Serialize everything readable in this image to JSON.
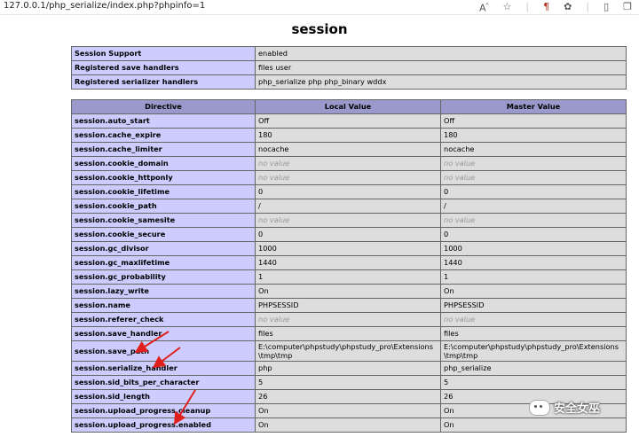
{
  "browser": {
    "url": "127.0.0.1/php_serialize/index.php?phpinfo=1",
    "icons": [
      "read-aloud-icon",
      "favorite-icon",
      "sidebar-icon",
      "extensions-icon",
      "split-screen-icon",
      "collections-icon"
    ]
  },
  "page": {
    "title": "session"
  },
  "summary_rows": [
    {
      "directive": "Session Support",
      "value": "enabled"
    },
    {
      "directive": "Registered save handlers",
      "value": "files user"
    },
    {
      "directive": "Registered serializer handlers",
      "value": "php_serialize php php_binary wddx"
    }
  ],
  "directives_header": {
    "directive": "Directive",
    "local": "Local Value",
    "master": "Master Value"
  },
  "directives": [
    {
      "name": "session.auto_start",
      "local": "Off",
      "master": "Off"
    },
    {
      "name": "session.cache_expire",
      "local": "180",
      "master": "180"
    },
    {
      "name": "session.cache_limiter",
      "local": "nocache",
      "master": "nocache"
    },
    {
      "name": "session.cookie_domain",
      "local": "no value",
      "master": "no value",
      "no_value": true
    },
    {
      "name": "session.cookie_httponly",
      "local": "no value",
      "master": "no value",
      "no_value": true
    },
    {
      "name": "session.cookie_lifetime",
      "local": "0",
      "master": "0"
    },
    {
      "name": "session.cookie_path",
      "local": "/",
      "master": "/"
    },
    {
      "name": "session.cookie_samesite",
      "local": "no value",
      "master": "no value",
      "no_value": true
    },
    {
      "name": "session.cookie_secure",
      "local": "0",
      "master": "0"
    },
    {
      "name": "session.gc_divisor",
      "local": "1000",
      "master": "1000"
    },
    {
      "name": "session.gc_maxlifetime",
      "local": "1440",
      "master": "1440"
    },
    {
      "name": "session.gc_probability",
      "local": "1",
      "master": "1"
    },
    {
      "name": "session.lazy_write",
      "local": "On",
      "master": "On"
    },
    {
      "name": "session.name",
      "local": "PHPSESSID",
      "master": "PHPSESSID"
    },
    {
      "name": "session.referer_check",
      "local": "no value",
      "master": "no value",
      "no_value": true
    },
    {
      "name": "session.save_handler",
      "local": "files",
      "master": "files"
    },
    {
      "name": "session.save_path",
      "local": "E:\\computer\\phpstudy\\phpstudy_pro\\Extensions\\tmp\\tmp",
      "master": "E:\\computer\\phpstudy\\phpstudy_pro\\Extensions\\tmp\\tmp",
      "tall": true
    },
    {
      "name": "session.serialize_handler",
      "local": "php",
      "master": "php_serialize"
    },
    {
      "name": "session.sid_bits_per_character",
      "local": "5",
      "master": "5"
    },
    {
      "name": "session.sid_length",
      "local": "26",
      "master": "26"
    },
    {
      "name": "session.upload_progress.cleanup",
      "local": "On",
      "master": "On"
    },
    {
      "name": "session.upload_progress.enabled",
      "local": "On",
      "master": "On"
    }
  ],
  "watermark": {
    "text": "安全女巫"
  },
  "colors": {
    "directive_bg": "#ccccff",
    "value_bg": "#dddddd",
    "header_bg": "#9999cc",
    "arrow": "#e0201c"
  }
}
